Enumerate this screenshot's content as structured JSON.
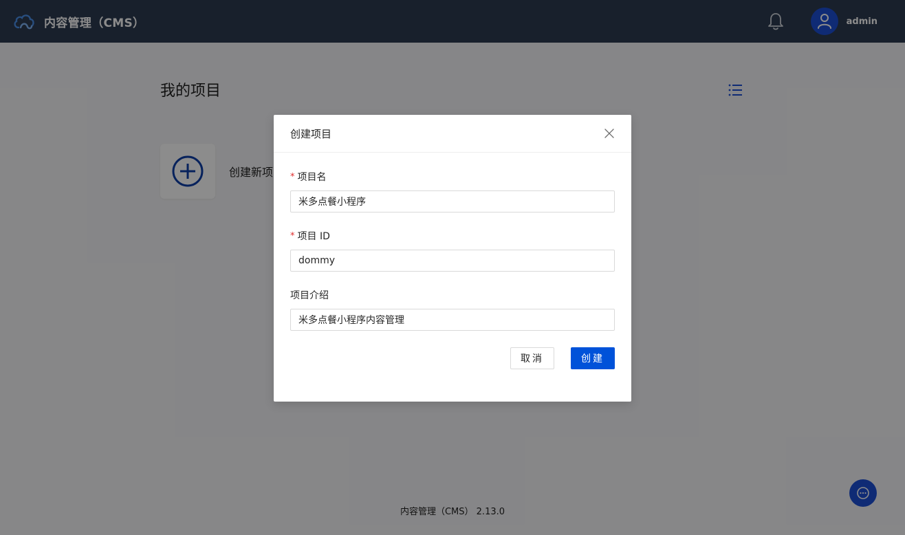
{
  "header": {
    "title": "内容管理（CMS）",
    "username": "admin",
    "logo_icon": "cloud-logo-icon",
    "bell_icon": "bell-icon",
    "avatar_icon": "user-avatar-icon"
  },
  "main": {
    "page_title": "我的项目",
    "create_card_label": "创建新项目",
    "footer": "内容管理（CMS） 2.13.0"
  },
  "modal": {
    "title": "创建项目",
    "fields": [
      {
        "label": "项目名",
        "required": true,
        "value": "米多点餐小程序"
      },
      {
        "label": "项目 ID",
        "required": true,
        "value": "dommy"
      },
      {
        "label": "项目介绍",
        "required": false,
        "value": "米多点餐小程序内容管理"
      }
    ],
    "cancel_label": "取消",
    "submit_label": "创建",
    "required_mark": "*"
  },
  "colors": {
    "header_bg": "#2d3b50",
    "accent": "#0052d9",
    "required": "#e02d2d"
  }
}
